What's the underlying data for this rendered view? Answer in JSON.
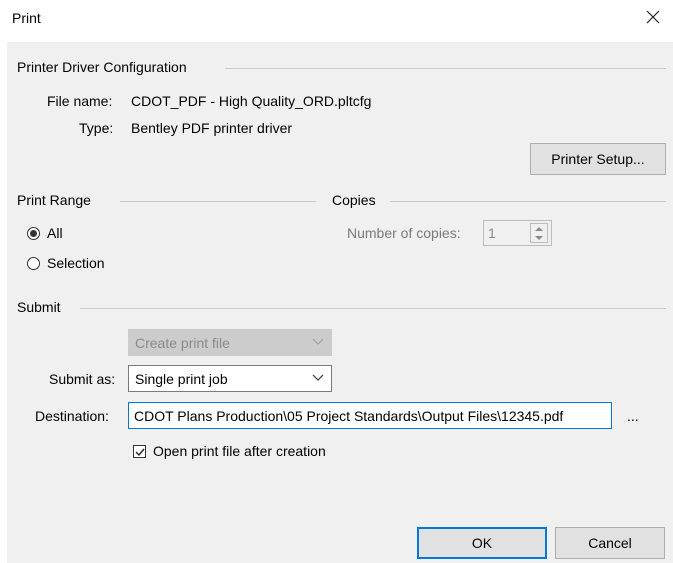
{
  "window": {
    "title": "Print",
    "close_icon": "close-icon"
  },
  "printer_driver": {
    "section_title": "Printer Driver Configuration",
    "file_name_label": "File name:",
    "file_name_value": "CDOT_PDF - High Quality_ORD.pltcfg",
    "type_label": "Type:",
    "type_value": "Bentley PDF printer driver",
    "printer_setup_button": "Printer Setup..."
  },
  "print_range": {
    "section_title": "Print Range",
    "option_all": "All",
    "option_selection": "Selection",
    "selected": "All"
  },
  "copies": {
    "section_title": "Copies",
    "number_label": "Number of copies:",
    "number_value": "1"
  },
  "submit": {
    "section_title": "Submit",
    "print_mode_value": "Create print file",
    "submit_as_label": "Submit as:",
    "submit_as_value": "Single print job",
    "destination_label": "Destination:",
    "destination_value": "CDOT Plans Production\\05 Project Standards\\Output Files\\12345.pdf",
    "browse_label": "...",
    "open_after_label": "Open print file after creation",
    "open_after_checked": true
  },
  "buttons": {
    "ok": "OK",
    "cancel": "Cancel"
  }
}
